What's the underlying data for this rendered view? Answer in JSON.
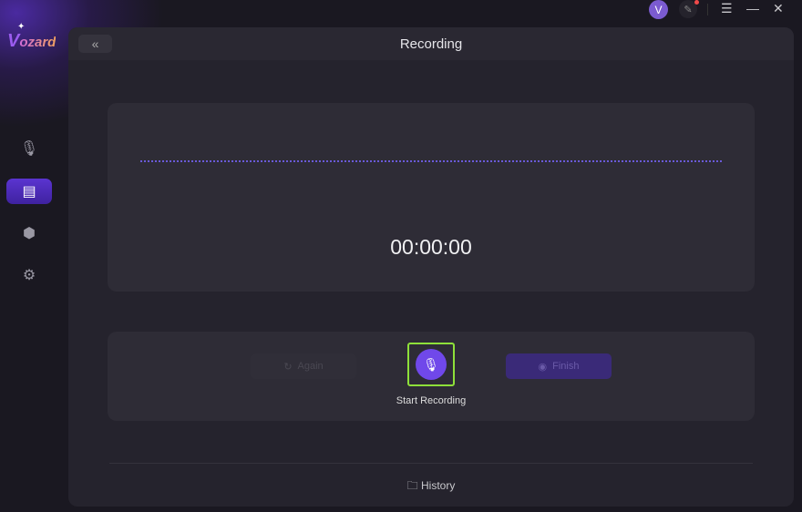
{
  "app": {
    "logo": "Vozard",
    "avatar_initial": "V"
  },
  "sidebar": {
    "items": [
      {
        "icon": "microphone-icon"
      },
      {
        "icon": "file-audio-icon",
        "active": true
      },
      {
        "icon": "share-icon"
      },
      {
        "icon": "gear-icon"
      }
    ]
  },
  "header": {
    "title": "Recording"
  },
  "recorder": {
    "timer": "00:00:00",
    "again_label": "Again",
    "finish_label": "Finish",
    "start_label": "Start Recording"
  },
  "footer": {
    "history_label": "History"
  },
  "colors": {
    "accent": "#7048ea",
    "highlight": "#8ee03a"
  }
}
